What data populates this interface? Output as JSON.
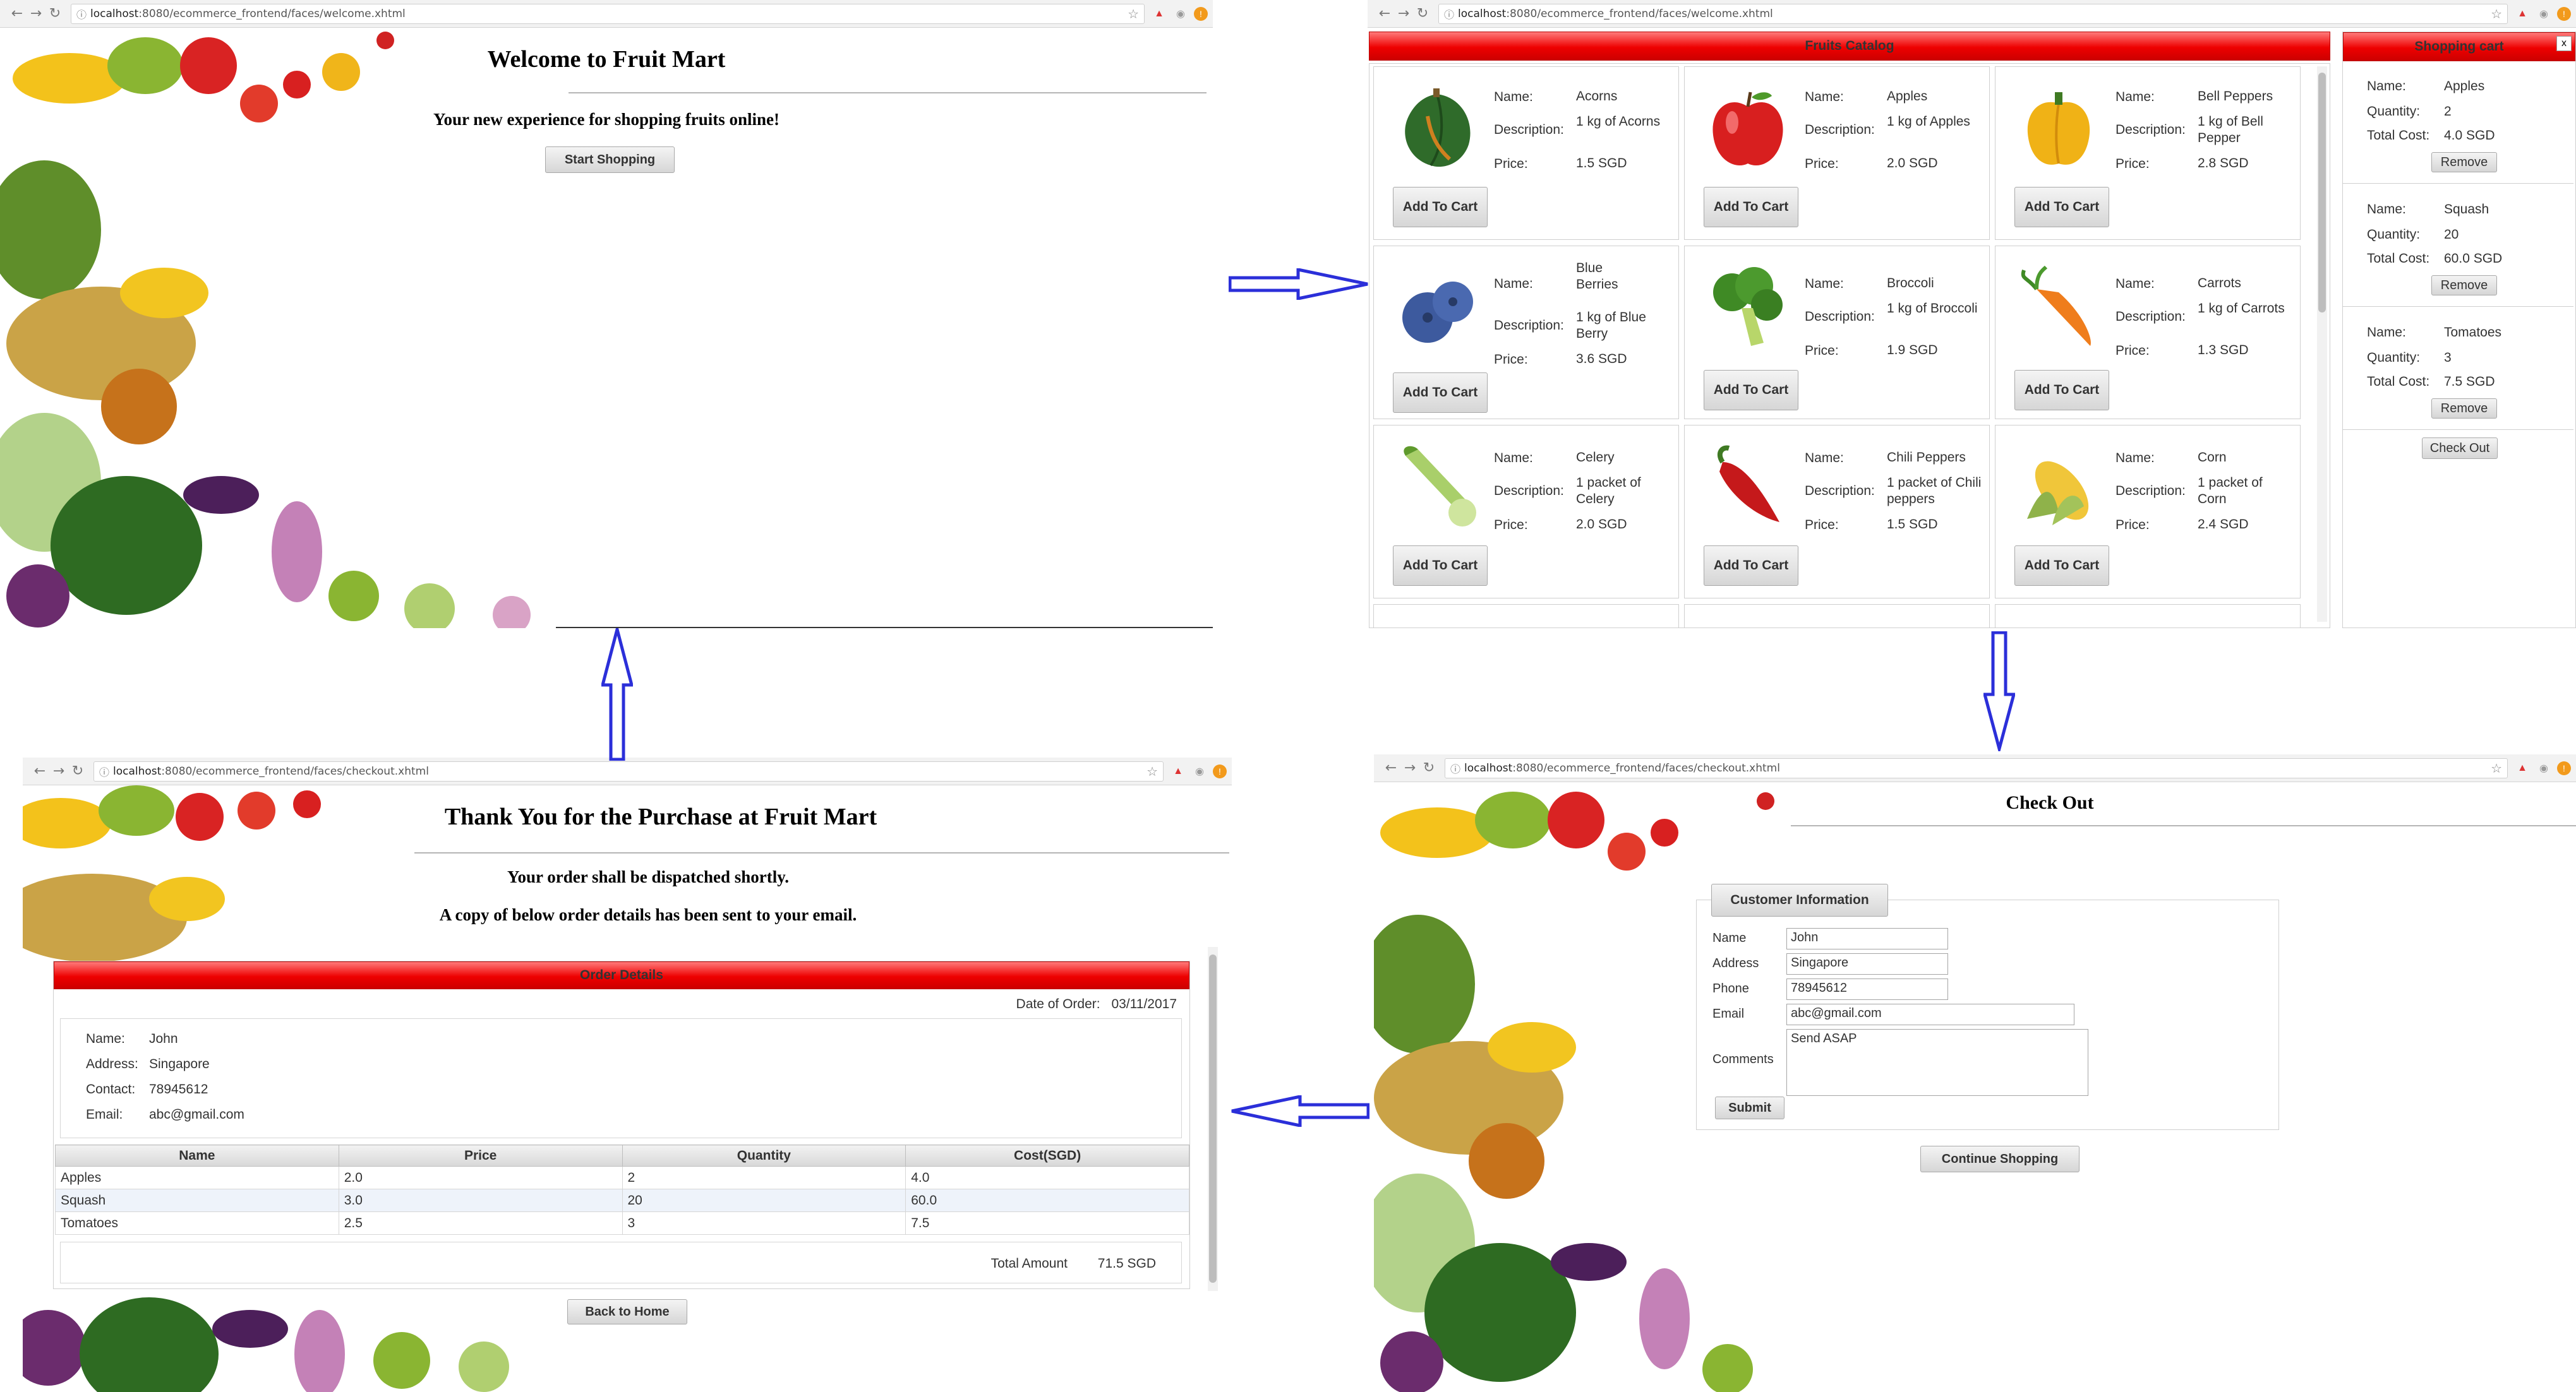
{
  "browser": {
    "url_welcome": {
      "host": "localhost",
      "rest": ":8080/ecommerce_frontend/faces/welcome.xhtml"
    },
    "url_catalog": {
      "host": "localhost",
      "rest": ":8080/ecommerce_frontend/faces/welcome.xhtml"
    },
    "url_thankyou": {
      "host": "localhost",
      "rest": ":8080/ecommerce_frontend/faces/checkout.xhtml"
    },
    "url_checkout": {
      "host": "localhost",
      "rest": ":8080/ecommerce_frontend/faces/checkout.xhtml"
    }
  },
  "welcome": {
    "title": "Welcome to Fruit Mart",
    "subtitle": "Your new experience for shopping fruits online!",
    "start_button": "Start Shopping"
  },
  "catalog": {
    "header": "Fruits Catalog",
    "name_label": "Name:",
    "description_label": "Description:",
    "price_label": "Price:",
    "add_button": "Add To Cart",
    "items": [
      {
        "name": "Acorns",
        "description": "1 kg of Acorns",
        "price": "1.5 SGD",
        "icon": "acorn-squash-icon"
      },
      {
        "name": "Apples",
        "description": "1 kg of Apples",
        "price": "2.0 SGD",
        "icon": "apple-icon"
      },
      {
        "name": "Bell Peppers",
        "description": "1 kg of Bell Pepper",
        "price": "2.8 SGD",
        "icon": "bell-pepper-icon"
      },
      {
        "name": "Blue Berries",
        "description": "1 kg of Blue Berry",
        "price": "3.6 SGD",
        "icon": "blueberry-icon"
      },
      {
        "name": "Broccoli",
        "description": "1 kg of Broccoli",
        "price": "1.9 SGD",
        "icon": "broccoli-icon"
      },
      {
        "name": "Carrots",
        "description": "1 kg of Carrots",
        "price": "1.3 SGD",
        "icon": "carrot-icon"
      },
      {
        "name": "Celery",
        "description": "1 packet of Celery",
        "price": "2.0 SGD",
        "icon": "celery-icon"
      },
      {
        "name": "Chili Peppers",
        "description": "1 packet of Chili peppers",
        "price": "1.5 SGD",
        "icon": "chili-pepper-icon"
      },
      {
        "name": "Corn",
        "description": "1 packet of Corn",
        "price": "2.4 SGD",
        "icon": "corn-icon"
      }
    ]
  },
  "cart": {
    "header": "Shopping cart",
    "name_label": "Name:",
    "quantity_label": "Quantity:",
    "total_label": "Total Cost:",
    "remove_button": "Remove",
    "checkout_button": "Check Out",
    "close_glyph": "x",
    "items": [
      {
        "name": "Apples",
        "quantity": "2",
        "total": "4.0 SGD"
      },
      {
        "name": "Squash",
        "quantity": "20",
        "total": "60.0 SGD"
      },
      {
        "name": "Tomatoes",
        "quantity": "3",
        "total": "7.5 SGD"
      }
    ]
  },
  "checkout": {
    "title": "Check Out",
    "legend": "Customer Information",
    "name_label": "Name",
    "address_label": "Address",
    "phone_label": "Phone",
    "email_label": "Email",
    "comments_label": "Comments",
    "name_value": "John",
    "address_value": "Singapore",
    "phone_value": "78945612",
    "email_value": "abc@gmail.com",
    "comments_value": "Send ASAP",
    "submit_button": "Submit",
    "continue_button": "Continue Shopping"
  },
  "thankyou": {
    "title": "Thank You for the Purchase at Fruit Mart",
    "line1": "Your order shall be dispatched shortly.",
    "line2": "A copy of below order details has been sent to your email.",
    "panel_header": "Order Details",
    "date_label": "Date of Order:",
    "date_value": "03/11/2017",
    "name_label": "Name:",
    "address_label": "Address:",
    "contact_label": "Contact:",
    "email_label": "Email:",
    "name_value": "John",
    "address_value": "Singapore",
    "contact_value": "78945612",
    "email_value": "abc@gmail.com",
    "columns": [
      "Name",
      "Price",
      "Quantity",
      "Cost(SGD)"
    ],
    "rows": [
      [
        "Apples",
        "2.0",
        "2",
        "4.0"
      ],
      [
        "Squash",
        "3.0",
        "20",
        "60.0"
      ],
      [
        "Tomatoes",
        "2.5",
        "3",
        "7.5"
      ]
    ],
    "total_label": "Total Amount",
    "total_value": "71.5 SGD",
    "back_button": "Back to Home"
  },
  "colors": {
    "header_red": "#ee0000",
    "flow_arrow": "#2b2fd9"
  }
}
